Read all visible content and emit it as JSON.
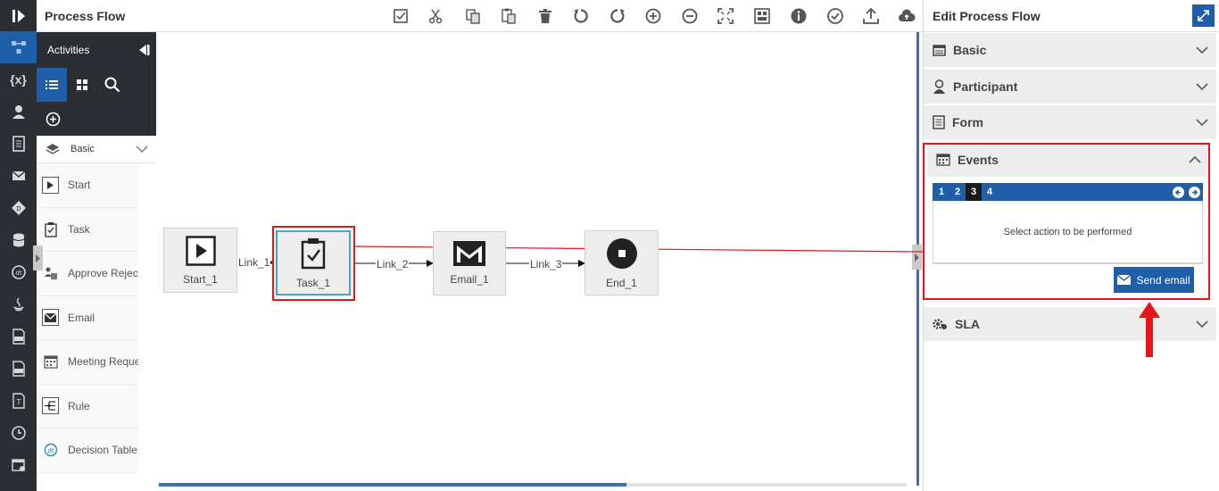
{
  "topbar": {
    "title": "Process Flow"
  },
  "activities": {
    "title": "Activities",
    "category": "Basic",
    "items": [
      {
        "label": "Start"
      },
      {
        "label": "Task"
      },
      {
        "label": "Approve Reject"
      },
      {
        "label": "Email"
      },
      {
        "label": "Meeting Request"
      },
      {
        "label": "Rule"
      },
      {
        "label": "Decision Table"
      }
    ]
  },
  "rail": {
    "variables_label": "{x}"
  },
  "flow": {
    "nodes": [
      {
        "label": "Start_1"
      },
      {
        "label": "Task_1"
      },
      {
        "label": "Email_1"
      },
      {
        "label": "End_1"
      }
    ],
    "links": [
      "Link_1",
      "Link_2",
      "Link_3"
    ]
  },
  "panel": {
    "title": "Edit Process Flow",
    "sections": {
      "basic": "Basic",
      "participant": "Participant",
      "form": "Form",
      "events": "Events",
      "sla": "SLA"
    },
    "events": {
      "tabs": [
        "1",
        "2",
        "3",
        "4"
      ],
      "active_tab": "3",
      "message": "Select action to be performed",
      "button": "Send email"
    }
  },
  "colors": {
    "accent": "#1f5fa9",
    "highlight": "#e8141b",
    "rail": "#2b2e33"
  }
}
